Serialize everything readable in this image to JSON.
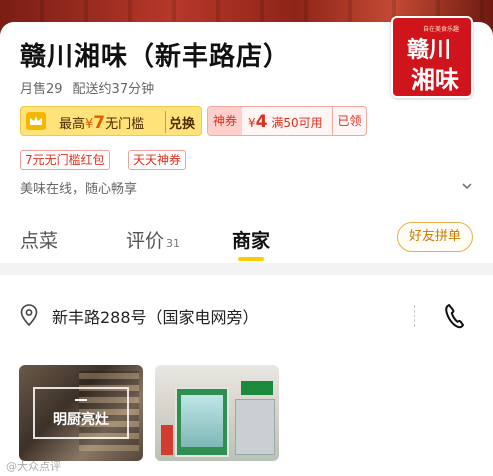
{
  "store": {
    "name": "赣川湘味（新丰路店）",
    "monthly_sales": "月售29",
    "delivery_time": "配送约37分钟",
    "slogan": "美味在线，随心畅享"
  },
  "logo": {
    "line1": "赣川",
    "line2": "湘味",
    "tiny_text": "自在美食乐趣"
  },
  "coupons": {
    "main": {
      "prefix": "最高",
      "currency": "¥",
      "amount": "7",
      "suffix": "无门槛",
      "action": "兑换"
    },
    "god": {
      "tag": "神券",
      "currency": "¥",
      "amount": "4",
      "condition": "满50可用",
      "status": "已领"
    },
    "pills": [
      "7元无门槛红包",
      "天天神券"
    ]
  },
  "tabs": [
    {
      "label": "点菜",
      "count": ""
    },
    {
      "label": "评价",
      "count": "31"
    },
    {
      "label": "商家",
      "count": ""
    }
  ],
  "group_button": "好友拼单",
  "address": "新丰路288号（国家电网旁）",
  "photos": [
    {
      "caption": "明厨亮灶"
    },
    {
      "caption": ""
    }
  ],
  "watermark": "@大众点评",
  "colors": {
    "accent_yellow": "#ffcc00",
    "coupon_red": "#d9301f",
    "logo_red": "#d0141c"
  },
  "icons": [
    "crown-icon",
    "chevron-down-icon",
    "location-pin-icon",
    "phone-icon"
  ]
}
